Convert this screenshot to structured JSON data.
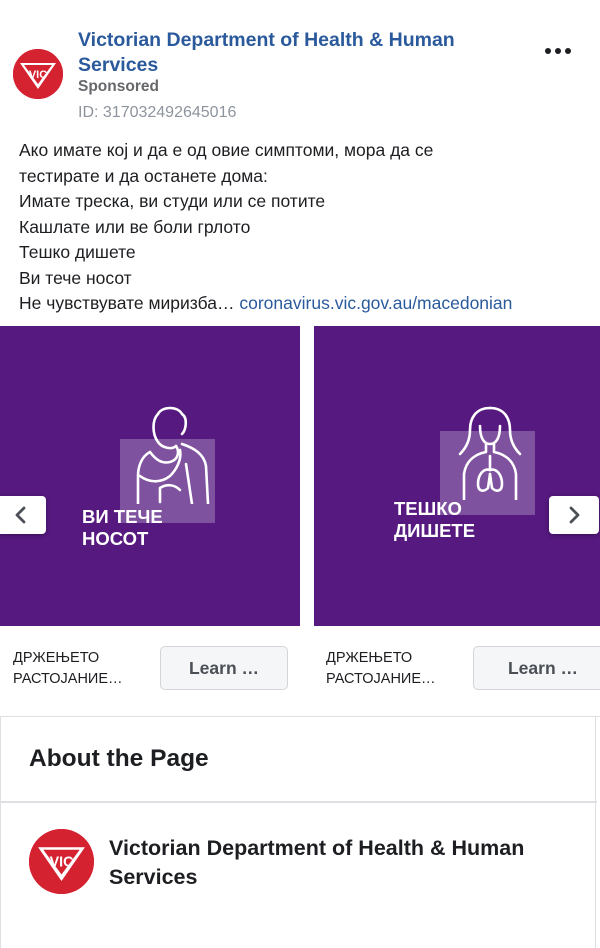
{
  "post": {
    "page_name": "Victorian Department of Health & Human Services",
    "sponsored_label": "Sponsored",
    "ad_id": "ID: 317032492645016",
    "logo_text": "VIC",
    "more_icon": "more-horizontal-icon",
    "text_lines": [
      "Ако имате кој и да е од овие симптоми, мора да се",
      "тестирате и да останете дома:",
      "Имате треска, ви студи или се потите",
      "Кашлате или ве боли грлото",
      "Тешко дишете",
      "Ви тече носот"
    ],
    "last_line_text": "Не чувствувате миризба…",
    "link_text": "coronavirus.vic.gov.au/macedonian"
  },
  "carousel": {
    "prev_icon": "chevron-left-icon",
    "next_icon": "chevron-right-icon",
    "cards": [
      {
        "headline_line1": "ВИ ТЕЧЕ",
        "headline_line2": "НОСОТ",
        "caption_line1": "ДРЖЕЊЕТО",
        "caption_line2": "РАСТОЈАНИЕ…",
        "button_label": "Learn …",
        "figure_icon": "person-sneezing-icon"
      },
      {
        "headline_line1": "ТЕШКО",
        "headline_line2": "ДИШЕТЕ",
        "caption_line1": "ДРЖЕЊЕТО",
        "caption_line2": "РАСТОЈАНИЕ…",
        "button_label": "Learn …",
        "figure_icon": "person-lungs-icon"
      }
    ]
  },
  "about": {
    "title": "About the Page",
    "page_name": "Victorian Department of Health & Human Services",
    "logo_text": "VIC"
  },
  "colors": {
    "link": "#2b5a9c",
    "card_background": "#55197f",
    "logo_red": "#d42231"
  }
}
